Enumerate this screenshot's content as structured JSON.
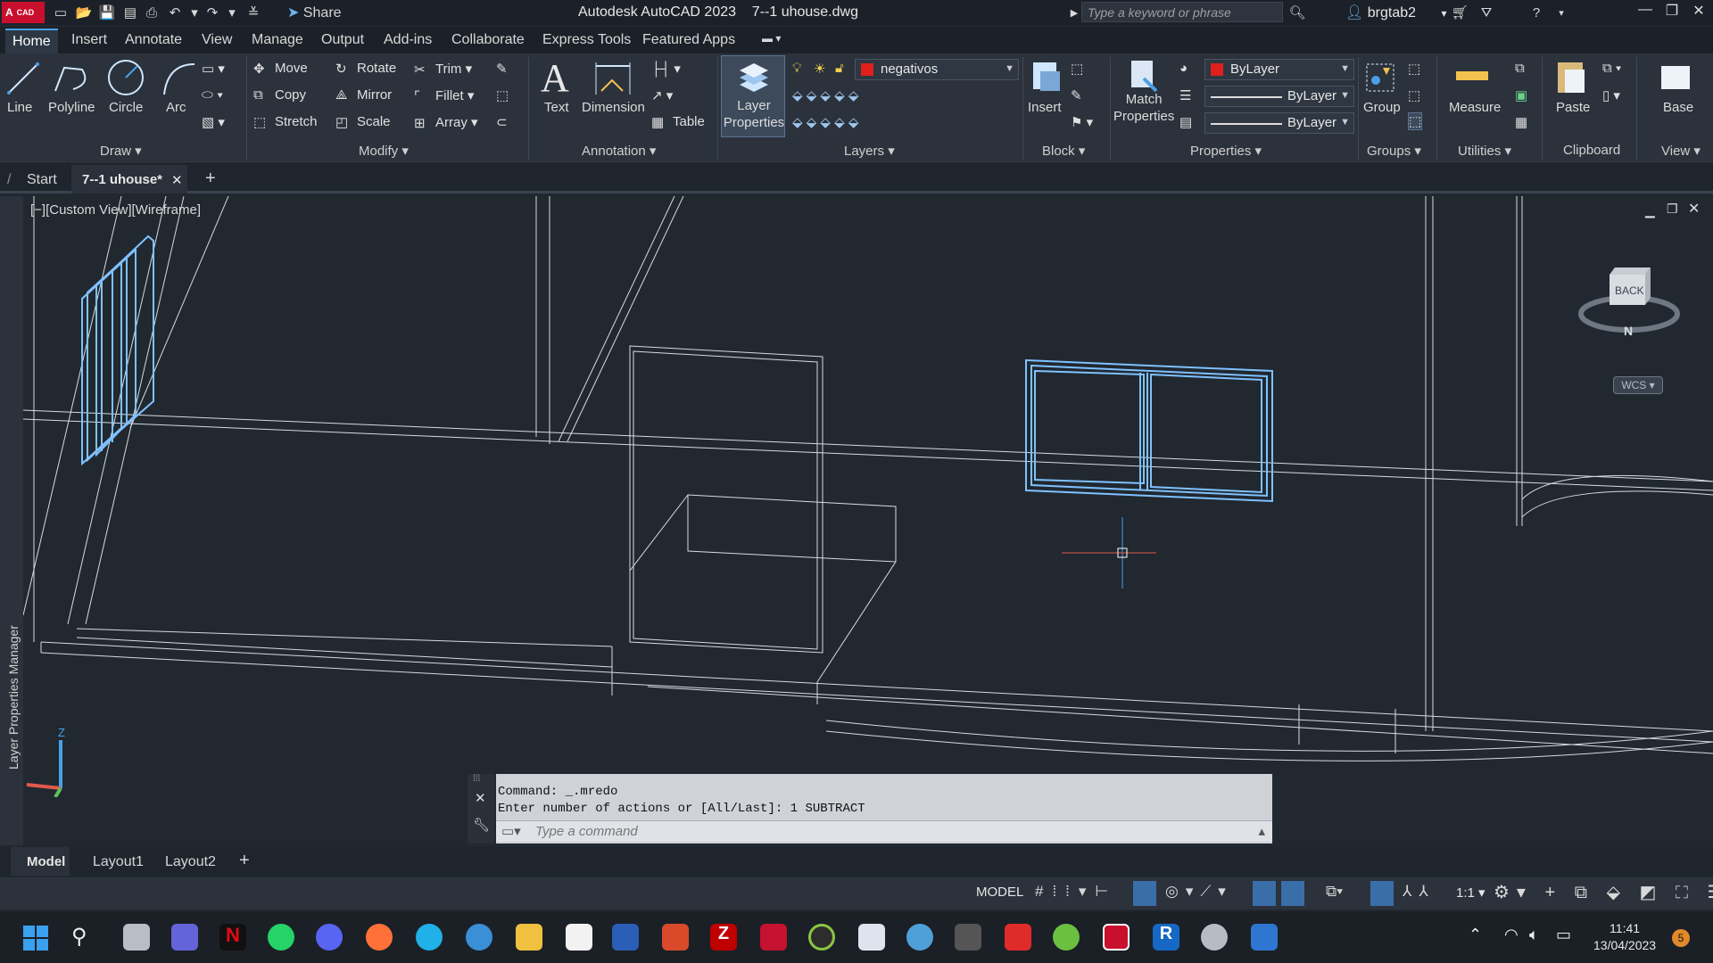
{
  "titlebar": {
    "app_badge": "A",
    "app_badge_sub": "CAD",
    "share_label": "Share",
    "window_title": "Autodesk AutoCAD 2023    7--1 uhouse.dwg",
    "search_placeholder": "Type a keyword or phrase",
    "username": "brgtab2"
  },
  "menu_tabs": [
    "Home",
    "Insert",
    "Annotate",
    "View",
    "Manage",
    "Output",
    "Add-ins",
    "Collaborate",
    "Express Tools",
    "Featured Apps"
  ],
  "ribbon": {
    "draw": {
      "line": "Line",
      "polyline": "Polyline",
      "circle": "Circle",
      "arc": "Arc",
      "title": "Draw"
    },
    "modify": {
      "move": "Move",
      "rotate": "Rotate",
      "trim": "Trim",
      "copy": "Copy",
      "mirror": "Mirror",
      "fillet": "Fillet",
      "stretch": "Stretch",
      "scale": "Scale",
      "array": "Array",
      "title": "Modify"
    },
    "annotation": {
      "text": "Text",
      "dimension": "Dimension",
      "table": "Table",
      "title": "Annotation"
    },
    "layers": {
      "layer_properties_1": "Layer",
      "layer_properties_2": "Properties",
      "current_layer": "negativos",
      "title": "Layers",
      "layer_color": "#e0201c"
    },
    "block": {
      "insert": "Insert",
      "title": "Block"
    },
    "properties": {
      "match_1": "Match",
      "match_2": "Properties",
      "color": "ByLayer",
      "linetype": "ByLayer",
      "lineweight": "ByLayer",
      "title": "Properties"
    },
    "groups": {
      "group": "Group",
      "title": "Groups"
    },
    "utilities": {
      "measure": "Measure",
      "title": "Utilities"
    },
    "clipboard": {
      "paste": "Paste",
      "title": "Clipboard"
    },
    "view": {
      "base": "Base",
      "title": "View"
    }
  },
  "doc_tabs": {
    "start": "Start",
    "active": "7--1 uhouse*",
    "add": "+"
  },
  "viewport": {
    "label": "[−][Custom View][Wireframe]",
    "side_panel": "Layer Properties Manager",
    "viewcube_face": "BACK",
    "viewcube_compass": "N",
    "wcs": "WCS",
    "ucs_z": "Z"
  },
  "command": {
    "line1": "Command: _.mredo",
    "line2": "Enter number of actions or [All/Last]: 1 SUBTRACT",
    "placeholder": "Type a command"
  },
  "layout_tabs": [
    "Model",
    "Layout1",
    "Layout2"
  ],
  "status": {
    "model": "MODEL",
    "scale": "1:1"
  },
  "taskbar": {
    "time": "11:41",
    "date": "13/04/2023",
    "badge": "5"
  }
}
